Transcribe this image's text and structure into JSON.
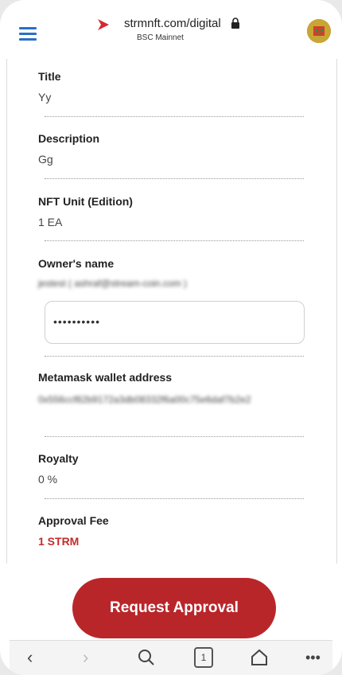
{
  "header": {
    "url": "strmnft.com/digital",
    "network": "BSC Mainnet"
  },
  "fields": {
    "title": {
      "label": "Title",
      "value": "Yy"
    },
    "description": {
      "label": "Description",
      "value": "Gg"
    },
    "nft_unit": {
      "label": "NFT Unit (Edition)",
      "value": "1 EA"
    },
    "owner": {
      "label": "Owner's name",
      "value": "jestest ( ashraf@stream-coin.com )",
      "password_mask": "••••••••••"
    },
    "wallet": {
      "label": "Metamask wallet address",
      "value": "0x556ccf82b9172a3db08332f6a00c75e6daf7b2e2"
    },
    "royalty": {
      "label": "Royalty",
      "value": "0 %"
    },
    "approval_fee": {
      "label": "Approval Fee",
      "value": "1 STRM"
    }
  },
  "cta": {
    "label": "Request Approval"
  },
  "browser_nav": {
    "tab_count": "1"
  },
  "colors": {
    "accent_red": "#b9262a",
    "link_blue": "#2a6fc9"
  }
}
